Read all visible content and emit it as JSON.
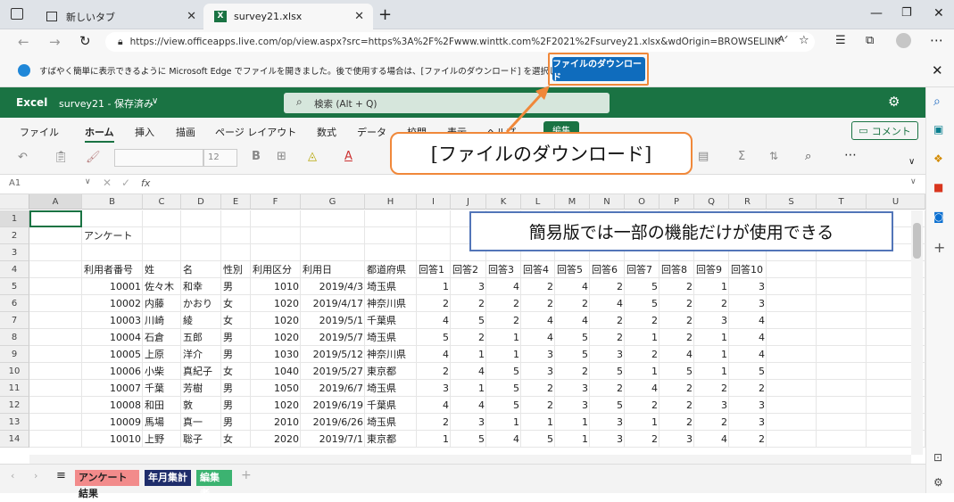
{
  "browser": {
    "tabs": [
      {
        "label": "新しいタブ"
      },
      {
        "label": "survey21.xlsx"
      }
    ],
    "url": "https://view.officeapps.live.com/op/view.aspx?src=https%3A%2F%2Fwww.winttk.com%2F2021%2Fsurvey21.xlsx&wdOrigin=BROWSELINK",
    "infobar_text": "すばやく簡単に表示できるように Microsoft Edge でファイルを開きました。後で使用する場合は、[ファイルのダウンロード] を選択してください。",
    "download_label": "ファイルのダウンロード"
  },
  "excel": {
    "app_name": "Excel",
    "doc_title": "survey21 - 保存済み",
    "search_placeholder": "検索 (Alt + Q)",
    "menu": [
      "ファイル",
      "ホーム",
      "挿入",
      "描画",
      "ページ レイアウト",
      "数式",
      "データ",
      "校閲",
      "表示",
      "ヘルプ",
      "編集"
    ],
    "comment_label": "コメント",
    "font_size": "12",
    "cell_ref": "A1",
    "fx": "fx",
    "columns": [
      "A",
      "B",
      "C",
      "D",
      "E",
      "F",
      "G",
      "H",
      "I",
      "J",
      "K",
      "L",
      "M",
      "N",
      "O",
      "P",
      "Q",
      "R",
      "S",
      "T",
      "U"
    ],
    "row_numbers": [
      "1",
      "2",
      "3",
      "4",
      "5",
      "6",
      "7",
      "8",
      "9",
      "10",
      "11",
      "12",
      "13",
      "14"
    ],
    "title_cell": "アンケート",
    "headers": [
      "利用者番号",
      "姓",
      "名",
      "性別",
      "利用区分",
      "利用日",
      "都道府県",
      "回答1",
      "回答2",
      "回答3",
      "回答4",
      "回答5",
      "回答6",
      "回答7",
      "回答8",
      "回答9",
      "回答10"
    ],
    "rows": [
      [
        "10001",
        "佐々木",
        "和幸",
        "男",
        "1010",
        "2019/4/3",
        "埼玉県",
        "1",
        "3",
        "4",
        "2",
        "4",
        "2",
        "5",
        "2",
        "1",
        "3"
      ],
      [
        "10002",
        "内藤",
        "かおり",
        "女",
        "1020",
        "2019/4/17",
        "神奈川県",
        "2",
        "2",
        "2",
        "2",
        "2",
        "4",
        "5",
        "2",
        "2",
        "3"
      ],
      [
        "10003",
        "川崎",
        "綾",
        "女",
        "1020",
        "2019/5/1",
        "千葉県",
        "4",
        "5",
        "2",
        "4",
        "4",
        "2",
        "2",
        "2",
        "3",
        "4"
      ],
      [
        "10004",
        "石倉",
        "五郎",
        "男",
        "1020",
        "2019/5/7",
        "埼玉県",
        "5",
        "2",
        "1",
        "4",
        "5",
        "2",
        "1",
        "2",
        "1",
        "4"
      ],
      [
        "10005",
        "上原",
        "洋介",
        "男",
        "1030",
        "2019/5/12",
        "神奈川県",
        "4",
        "1",
        "1",
        "3",
        "5",
        "3",
        "2",
        "4",
        "1",
        "4"
      ],
      [
        "10006",
        "小柴",
        "真紀子",
        "女",
        "1040",
        "2019/5/27",
        "東京都",
        "2",
        "4",
        "5",
        "3",
        "2",
        "5",
        "1",
        "5",
        "1",
        "5"
      ],
      [
        "10007",
        "千葉",
        "芳樹",
        "男",
        "1050",
        "2019/6/7",
        "埼玉県",
        "3",
        "1",
        "5",
        "2",
        "3",
        "2",
        "4",
        "2",
        "2",
        "2"
      ],
      [
        "10008",
        "和田",
        "敦",
        "男",
        "1020",
        "2019/6/19",
        "千葉県",
        "4",
        "4",
        "5",
        "2",
        "3",
        "5",
        "2",
        "2",
        "3",
        "3"
      ],
      [
        "10009",
        "馬場",
        "真一",
        "男",
        "2010",
        "2019/6/26",
        "埼玉県",
        "2",
        "3",
        "1",
        "1",
        "1",
        "3",
        "1",
        "2",
        "2",
        "3"
      ],
      [
        "10010",
        "上野",
        "聡子",
        "女",
        "2020",
        "2019/7/1",
        "東京都",
        "1",
        "5",
        "4",
        "5",
        "1",
        "3",
        "2",
        "3",
        "4",
        "2"
      ]
    ],
    "sheets": [
      {
        "label": "アンケート結果",
        "color": "#f28b8b",
        "text": "#222"
      },
      {
        "label": "年月集計",
        "color": "#1f2d6b",
        "text": "#ffffff"
      },
      {
        "label": "編集者",
        "color": "#3cb371",
        "text": "#ffffff"
      }
    ]
  },
  "callouts": {
    "download": "[ファイルのダウンロード]",
    "limited": "簡易版では一部の機能だけが使用できる"
  },
  "colors": {
    "excel_green": "#1a7343",
    "download_blue": "#0f6cbd",
    "orange": "#f0883a",
    "callout_blue": "#5275b8"
  }
}
